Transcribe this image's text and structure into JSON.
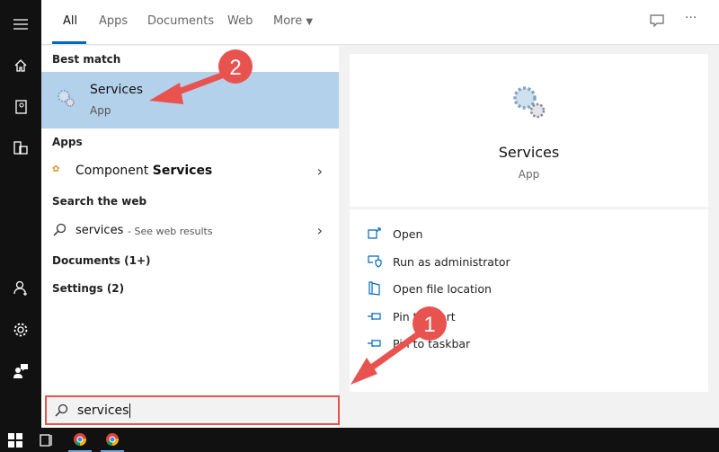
{
  "tabs": [
    {
      "label": "All"
    },
    {
      "label": "Apps"
    },
    {
      "label": "Documents"
    },
    {
      "label": "Web"
    },
    {
      "label": "More"
    }
  ],
  "rail_icons": [
    "hamburger-icon",
    "home-icon",
    "notebook-icon",
    "devices-icon",
    "add-user-icon",
    "gear-icon",
    "feedback-icon"
  ],
  "results": {
    "best_match_header": "Best match",
    "best_match": {
      "title": "Services",
      "subtitle": "App",
      "icon": "gears-icon"
    },
    "apps_header": "Apps",
    "apps": [
      {
        "prefix": "Component ",
        "bold": "Services",
        "icon": "component-services-icon"
      }
    ],
    "web_header": "Search the web",
    "web": {
      "query": "services",
      "suffix": " - See web results"
    },
    "documents_header": "Documents (1+)",
    "settings_header": "Settings (2)"
  },
  "detail": {
    "title": "Services",
    "subtitle": "App",
    "actions": [
      {
        "label": "Open",
        "icon": "open-icon"
      },
      {
        "label": "Run as administrator",
        "icon": "shield-icon"
      },
      {
        "label": "Open file location",
        "icon": "folder-icon"
      },
      {
        "label": "Pin to Start",
        "icon": "pin-icon"
      },
      {
        "label": "Pin to taskbar",
        "icon": "pin-icon"
      }
    ]
  },
  "search": {
    "value": "services"
  },
  "annotations": [
    {
      "label": "1"
    },
    {
      "label": "2"
    }
  ],
  "colors": {
    "accent": "#0067c0",
    "selected": "#b3d1ea",
    "annotation": "#e8534f"
  }
}
